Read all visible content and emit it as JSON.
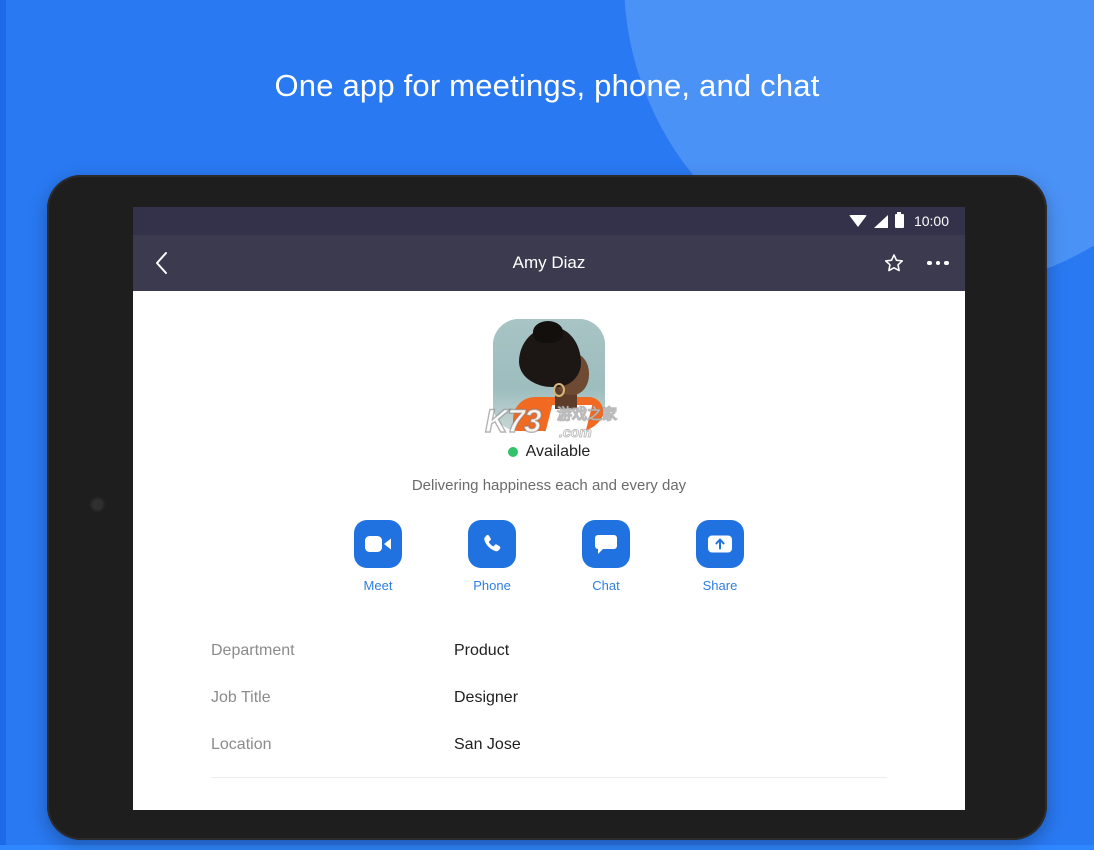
{
  "promo": {
    "headline": "One app for meetings, phone, and chat",
    "background_color": "#2979f2",
    "blob_color": "#4b92f7"
  },
  "device": {
    "frame_color": "#1e1e1e",
    "camera": "front-camera"
  },
  "status_bar": {
    "time": "10:00",
    "icons": [
      "wifi-icon",
      "signal-icon",
      "battery-icon"
    ],
    "background_color": "#33324a"
  },
  "appbar": {
    "title": "Amy Diaz",
    "back_icon": "back-chevron-icon",
    "favorite_icon": "star-outline-icon",
    "overflow_icon": "more-dots-icon",
    "background_color": "#3b3a4e"
  },
  "profile": {
    "avatar_alt": "Amy Diaz profile photo",
    "presence_status": "Available",
    "presence_color": "#33c26a",
    "tagline": "Delivering happiness each and every day",
    "watermark": {
      "primary": "K73",
      "secondary": "游戏之家",
      "tertiary": ".com"
    }
  },
  "actions": [
    {
      "label": "Meet",
      "icon": "video-camera-icon"
    },
    {
      "label": "Phone",
      "icon": "phone-handset-icon"
    },
    {
      "label": "Chat",
      "icon": "chat-bubble-icon"
    },
    {
      "label": "Share",
      "icon": "share-upload-icon"
    }
  ],
  "action_accent_color": "#1f72e0",
  "details": [
    {
      "label": "Department",
      "value": "Product"
    },
    {
      "label": "Job Title",
      "value": "Designer"
    },
    {
      "label": "Location",
      "value": "San Jose"
    }
  ]
}
